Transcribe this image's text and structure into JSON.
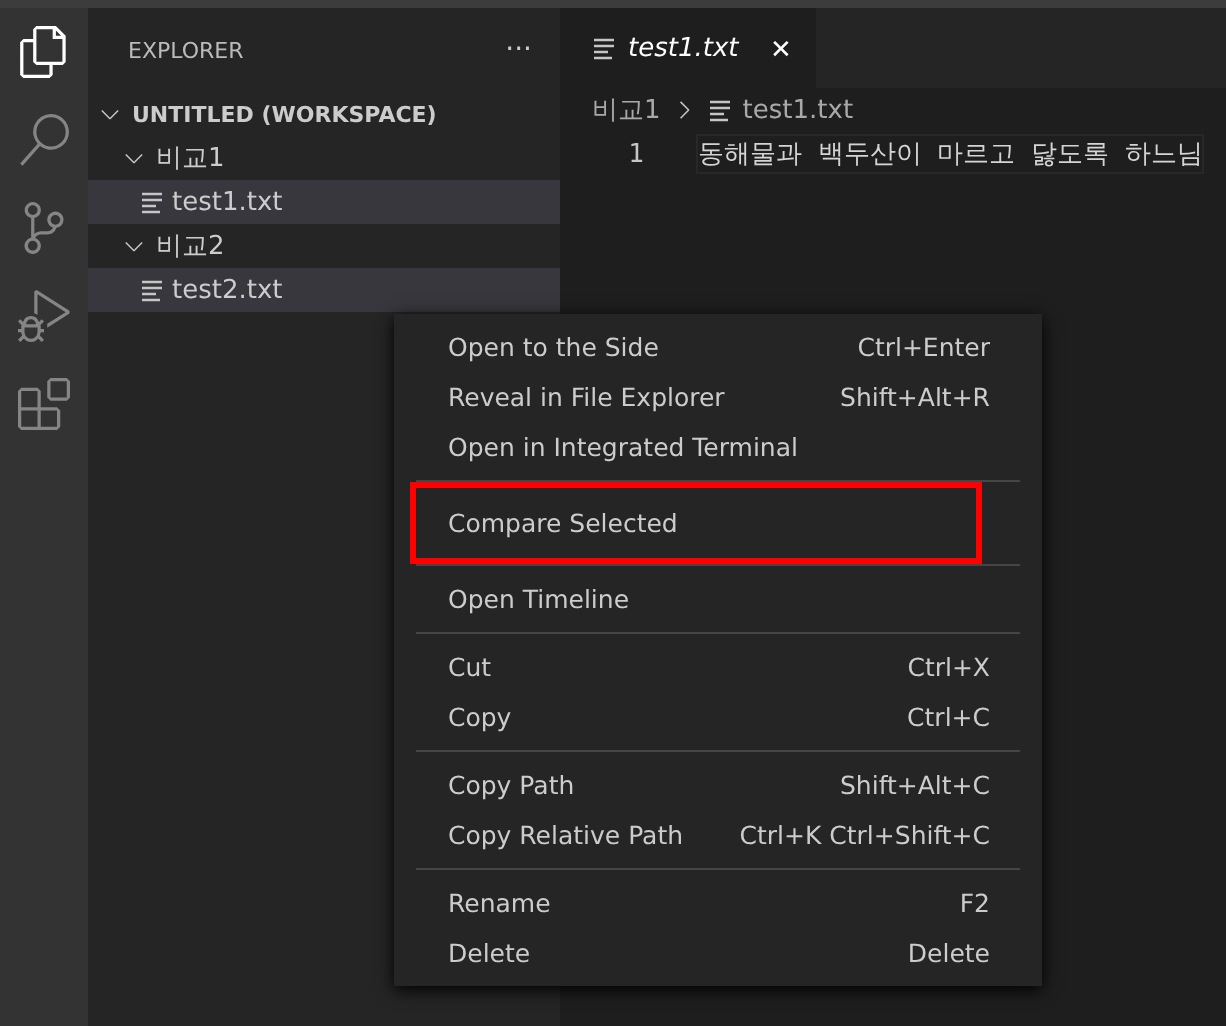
{
  "sidebar": {
    "title": "EXPLORER",
    "more": "···",
    "workspace": {
      "label": "UNTITLED (WORKSPACE)",
      "expanded": true,
      "children": [
        {
          "label": "비교1",
          "expanded": true,
          "children": [
            {
              "label": "test1.txt",
              "selected": true
            }
          ]
        },
        {
          "label": "비교2",
          "expanded": true,
          "children": [
            {
              "label": "test2.txt",
              "selected": true
            }
          ]
        }
      ]
    }
  },
  "activity_bar": [
    {
      "kind": "files",
      "selected": true
    },
    {
      "kind": "search",
      "selected": false
    },
    {
      "kind": "scm",
      "selected": false
    },
    {
      "kind": "debug",
      "selected": false
    },
    {
      "kind": "extensions",
      "selected": false
    }
  ],
  "tabs": [
    {
      "label": "test1.txt",
      "selected": true,
      "close": "✕"
    }
  ],
  "breadcrumb": [
    "비교1",
    "test1.txt"
  ],
  "editor": {
    "lines": [
      {
        "number": "1",
        "text": "동해물과 백두산이 마르고 닳도록 하느님"
      }
    ]
  },
  "context_menu": [
    [
      {
        "label": "Open to the Side",
        "shortcut": "Ctrl+Enter",
        "highlighted": false
      },
      {
        "label": "Reveal in File Explorer",
        "shortcut": "Shift+Alt+R",
        "highlighted": false
      },
      {
        "label": "Open in Integrated Terminal",
        "highlighted": false
      }
    ],
    [
      {
        "label": "Compare Selected",
        "highlighted": true
      }
    ],
    [
      {
        "label": "Open Timeline",
        "highlighted": false
      }
    ],
    [
      {
        "label": "Cut",
        "shortcut": "Ctrl+X",
        "highlighted": false
      },
      {
        "label": "Copy",
        "shortcut": "Ctrl+C",
        "highlighted": false
      }
    ],
    [
      {
        "label": "Copy Path",
        "shortcut": "Shift+Alt+C",
        "highlighted": false
      },
      {
        "label": "Copy Relative Path",
        "shortcut": "Ctrl+K Ctrl+Shift+C",
        "highlighted": false
      }
    ],
    [
      {
        "label": "Rename",
        "shortcut": "F2",
        "highlighted": false
      },
      {
        "label": "Delete",
        "shortcut": "Delete",
        "highlighted": false
      }
    ]
  ]
}
